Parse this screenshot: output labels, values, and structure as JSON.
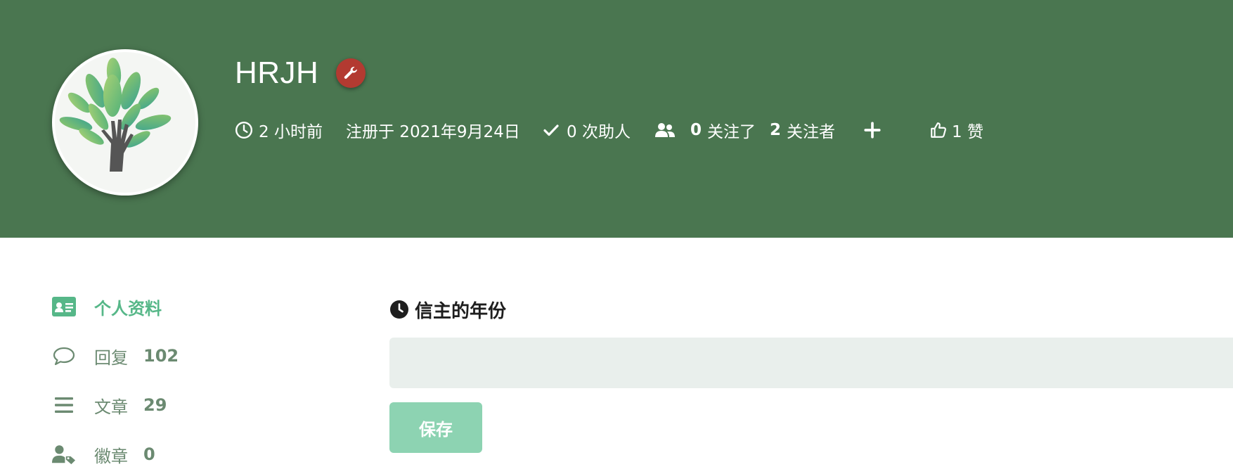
{
  "colors": {
    "hero_bg": "#4a7650",
    "admin_badge": "#b33a31",
    "accent_active": "#56b788",
    "nav_text": "#6b8a71",
    "input_bg": "#e9efec",
    "save_button_bg": "#8dd3b2"
  },
  "profile": {
    "avatar_icon": "tree-hand-logo",
    "username": "HRJH",
    "admin_icon": "wrench-icon",
    "last_seen": "2 小时前",
    "registered": "注册于 2021年9月24日",
    "solutions_text": "0 次助人",
    "following_count": "0",
    "following_label": "关注了",
    "followers_count": "2",
    "followers_label": "关注者",
    "follow_icon": "plus-icon",
    "likes_text": "1 赞"
  },
  "sidebar": {
    "items": [
      {
        "label": "个人资料",
        "count": "",
        "icon": "id-card-icon",
        "active": true
      },
      {
        "label": "回复",
        "count": "102",
        "icon": "speech-bubble-icon",
        "active": false
      },
      {
        "label": "文章",
        "count": "29",
        "icon": "list-icon",
        "active": false
      },
      {
        "label": "徽章",
        "count": "0",
        "icon": "user-tag-icon",
        "active": false
      }
    ]
  },
  "form": {
    "field_icon": "clock-icon",
    "field_label": "信主的年份",
    "field_value": "",
    "save_label": "保存"
  }
}
